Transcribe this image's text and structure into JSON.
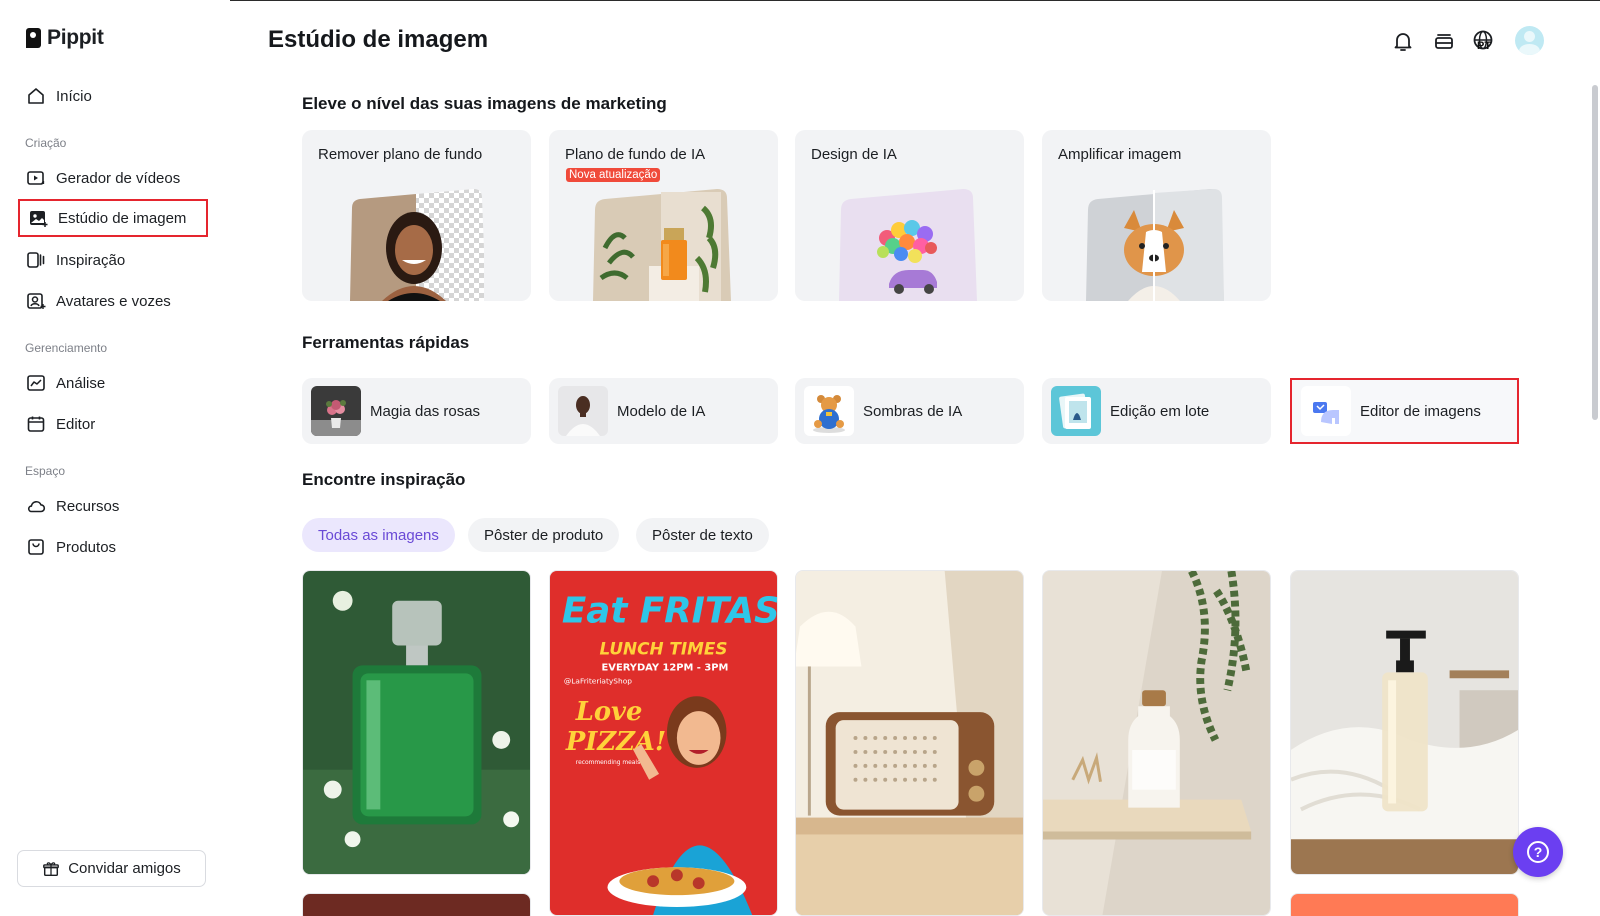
{
  "app": {
    "name": "Pippit",
    "page_title": "Estúdio de imagem",
    "language": "PT"
  },
  "sidebar": {
    "home": "Início",
    "sections": {
      "creation": "Criação",
      "management": "Gerenciamento",
      "space": "Espaço"
    },
    "items": {
      "video_generator": "Gerador de vídeos",
      "image_studio": "Estúdio de imagem",
      "inspiration": "Inspiração",
      "avatars_voices": "Avatares e vozes",
      "analytics": "Análise",
      "editor": "Editor",
      "resources": "Recursos",
      "products": "Produtos"
    },
    "invite": "Convidar amigos"
  },
  "marketing": {
    "title": "Eleve o nível das suas imagens de marketing",
    "cards": [
      {
        "label": "Remover plano de fundo"
      },
      {
        "label": "Plano de fundo de IA",
        "badge": "Nova atualização"
      },
      {
        "label": "Design de IA"
      },
      {
        "label": "Amplificar imagem"
      }
    ]
  },
  "quick_tools": {
    "title": "Ferramentas rápidas",
    "items": [
      "Magia das rosas",
      "Modelo de IA",
      "Sombras de IA",
      "Edição em lote",
      "Editor de imagens"
    ]
  },
  "inspiration": {
    "title": "Encontre inspiração",
    "filters": [
      "Todas as imagens",
      "Pôster de produto",
      "Pôster de texto"
    ],
    "poster": {
      "headline": "Eat FRITAS!",
      "sub": "LUNCH TIMES",
      "hours": "EVERYDAY 12PM - 3PM",
      "handle": "@LaFriteriatyShop",
      "script1": "Love",
      "script2": "PIZZA!",
      "tag": "recommending meals"
    }
  },
  "colors": {
    "accent": "#6b3ff1",
    "highlight": "#e5252e",
    "badge": "#f04a3a"
  }
}
